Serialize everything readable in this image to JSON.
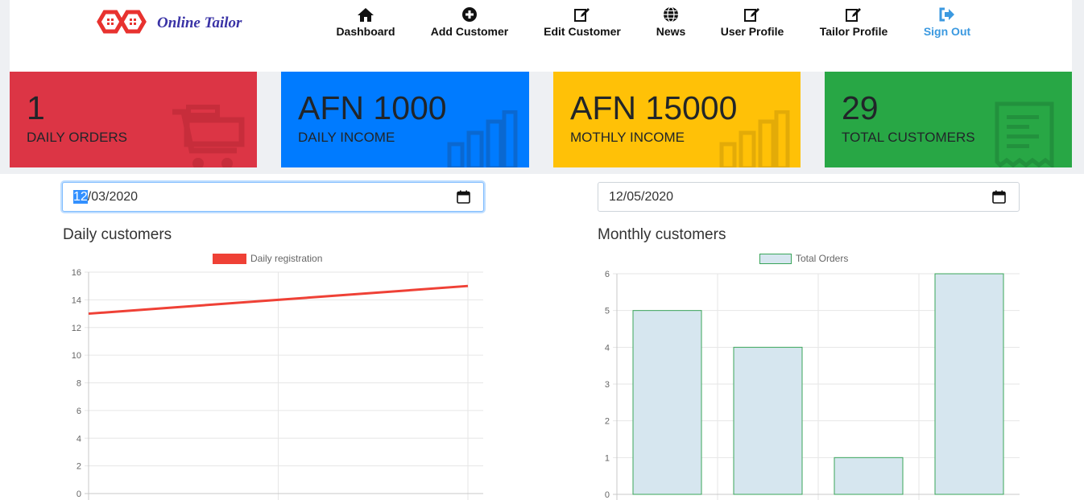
{
  "brand": {
    "name": "Online Tailor",
    "logo_colors": [
      "#e8322f",
      "#e8322f"
    ]
  },
  "nav": {
    "items": [
      {
        "label": "Dashboard",
        "icon": "home-icon"
      },
      {
        "label": "Add Customer",
        "icon": "plus-circle-icon"
      },
      {
        "label": "Edit Customer",
        "icon": "edit-icon"
      },
      {
        "label": "News",
        "icon": "globe-icon"
      },
      {
        "label": "User Profile",
        "icon": "edit-icon"
      },
      {
        "label": "Tailor Profile",
        "icon": "edit-icon"
      },
      {
        "label": "Sign Out",
        "icon": "sign-out-icon"
      }
    ]
  },
  "cards": [
    {
      "value": "1",
      "caption": "DAILY ORDERS",
      "color": "#dc3545",
      "icon": "shopping-cart-icon"
    },
    {
      "value": "AFN 1000",
      "caption": "DAILY INCOME",
      "color": "#007bff",
      "icon": "bar-chart-icon"
    },
    {
      "value": "AFN 15000",
      "caption": "MOTHLY INCOME",
      "color": "#ffc107",
      "icon": "bar-chart-icon"
    },
    {
      "value": "29",
      "caption": "TOTAL CUSTOMERS",
      "color": "#28a745",
      "icon": "receipt-icon"
    }
  ],
  "filters": {
    "daily_date": {
      "highlight": "12",
      "rest": "/03/2020"
    },
    "monthly_date": "12/05/2020"
  },
  "daily_section": {
    "title": "Daily customers"
  },
  "monthly_section": {
    "title": "Monthly customers"
  },
  "chart_data": [
    {
      "type": "line",
      "legend": "Daily registration",
      "series": [
        {
          "name": "Daily registration",
          "values": [
            13,
            14,
            15
          ],
          "color": "#ef4136"
        }
      ],
      "ylim": [
        0,
        16
      ],
      "yticks": [
        "0",
        "2",
        "4",
        "6",
        "8",
        "10",
        "12",
        "14",
        "16"
      ],
      "grid": true,
      "legend_position": "top"
    },
    {
      "type": "bar",
      "legend": "Total Orders",
      "series": [
        {
          "name": "Total Orders",
          "values": [
            5,
            4,
            1,
            6
          ],
          "fill": "#d6e6ef",
          "stroke": "#3aa55a"
        }
      ],
      "ylim": [
        0,
        6
      ],
      "yticks": [
        "0",
        "1",
        "2",
        "3",
        "4",
        "5",
        "6"
      ],
      "grid": true,
      "legend_position": "top"
    }
  ]
}
